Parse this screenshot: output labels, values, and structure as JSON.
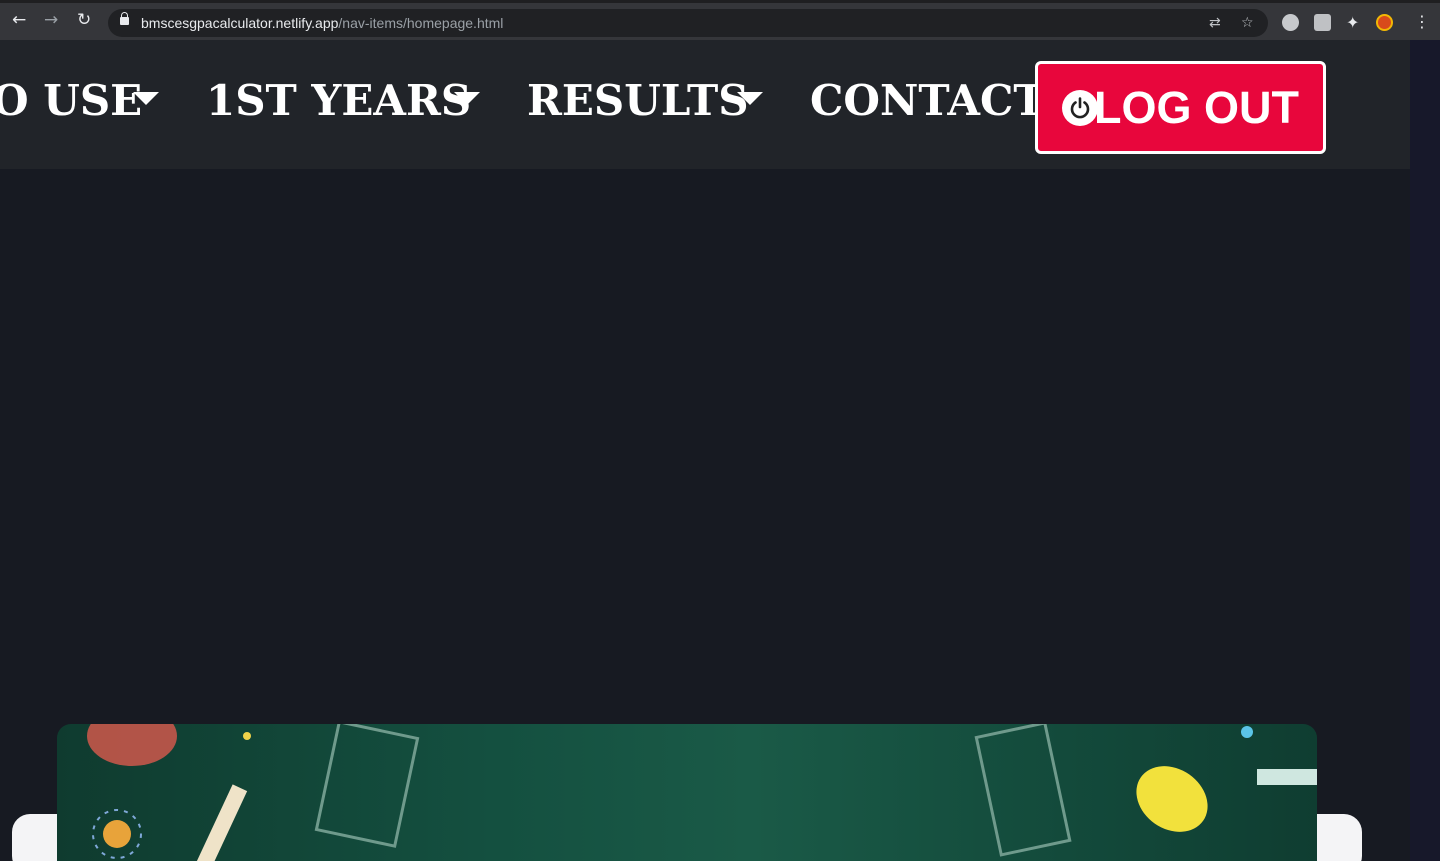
{
  "browser": {
    "url_host": "bmscesgpacalculator.netlify.app",
    "url_path": "/nav-items/homepage.html"
  },
  "nav": {
    "items": [
      {
        "label": "O USE"
      },
      {
        "label": "1ST YEARS"
      },
      {
        "label": "RESULTS"
      },
      {
        "label": "CONTACT"
      }
    ],
    "logout_label": "LOG OUT"
  },
  "colors": {
    "logout_bg": "#e8063c",
    "nav_bg": "#212429",
    "page_bg": "#171a22"
  }
}
